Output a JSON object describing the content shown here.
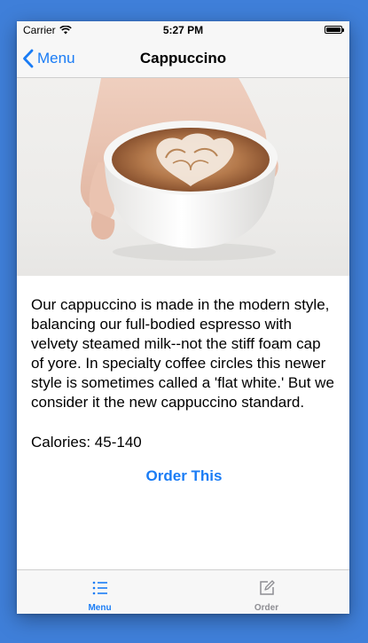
{
  "status_bar": {
    "carrier": "Carrier",
    "time": "5:27 PM",
    "icons": [
      "wifi-icon",
      "battery-icon"
    ]
  },
  "nav": {
    "back_label": "Menu",
    "back_icon": "chevron-left-icon",
    "title": "Cappuccino"
  },
  "hero": {
    "subject": "cappuccino-latte-art-photo"
  },
  "content": {
    "description": "Our cappuccino is made in the modern style, balancing our full-bodied espresso with velvety steamed milk--not the stiff foam cap of yore. In specialty coffee circles this newer style is sometimes called a 'flat white.' But we consider it the new cappuccino standard.",
    "calories": "Calories: 45-140",
    "order_label": "Order This"
  },
  "tab_bar": {
    "tabs": [
      {
        "label": "Menu",
        "icon": "list-icon",
        "selected": true
      },
      {
        "label": "Order",
        "icon": "edit-icon",
        "selected": false
      }
    ]
  },
  "colors": {
    "background": "#3f7fd9",
    "accent": "#1a7cf5",
    "inactive": "#8e8e93",
    "bar": "#f7f7f7"
  }
}
